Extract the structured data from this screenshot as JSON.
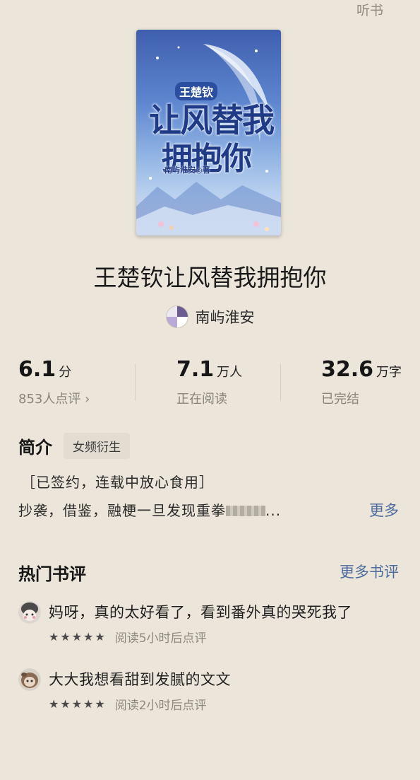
{
  "header": {
    "listen_label": "听书"
  },
  "book": {
    "cover": {
      "small_title": "王楚钦",
      "line1": "让风替我",
      "line2": "拥抱你",
      "author_mark": "南屿淮安◎著"
    },
    "title": "王楚钦让风替我拥抱你",
    "author": "南屿淮安"
  },
  "stats": {
    "score": {
      "value": "6.1",
      "unit": "分",
      "label": "853人点评 ›"
    },
    "readers": {
      "value": "7.1",
      "unit": "万人",
      "label": "正在阅读"
    },
    "words": {
      "value": "32.6",
      "unit": "万字",
      "label": "已完结"
    }
  },
  "intro": {
    "heading": "简介",
    "tag": "女频衍生",
    "line1": "［已签约，连载中放心食用］",
    "line2": "抄袭，借鉴，融梗一旦发现重拳",
    "line2_suffix": "...",
    "more": "更多"
  },
  "reviews": {
    "heading": "热门书评",
    "more": "更多书评",
    "items": [
      {
        "text": "妈呀，真的太好看了，看到番外真的哭死我了",
        "stars": 5,
        "time": "阅读5小时后点评"
      },
      {
        "text": "大大我想看甜到发腻的文文",
        "stars": 5,
        "time": "阅读2小时后点评"
      }
    ]
  },
  "colors": {
    "background": "#ebe6d9",
    "link": "#4d6c9e",
    "muted": "#8a857c"
  }
}
